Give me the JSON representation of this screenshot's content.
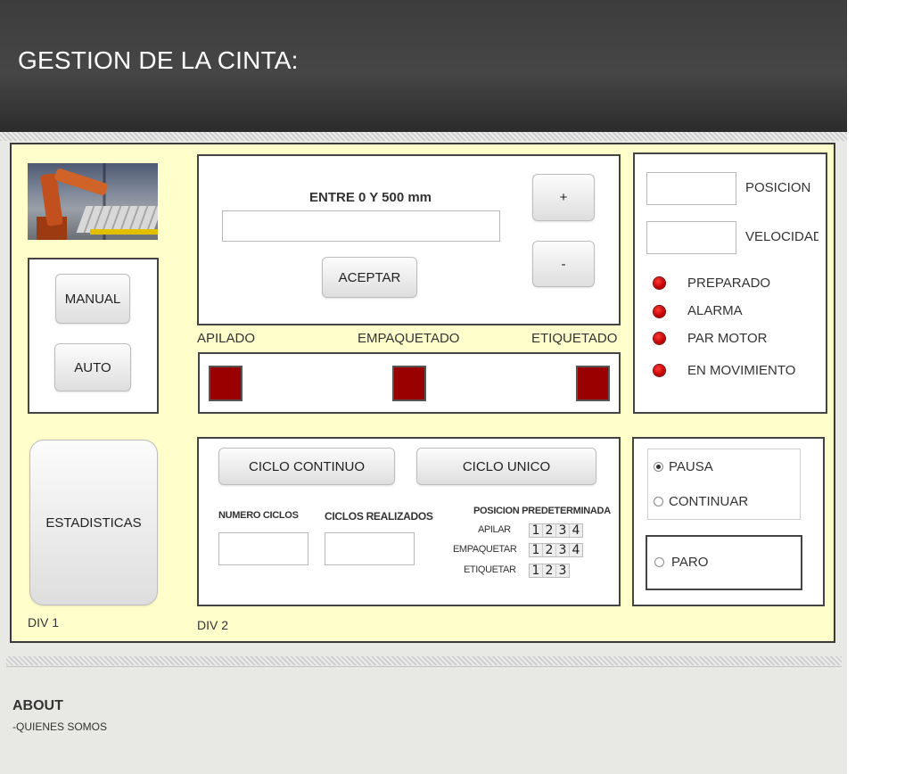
{
  "header": {
    "title": "GESTION DE LA CINTA:"
  },
  "div1": {
    "label": "DIV 1",
    "mode_buttons": {
      "manual": "MANUAL",
      "auto": "AUTO"
    },
    "stats_button": "ESTADISTICAS"
  },
  "position_panel": {
    "prompt": "ENTRE 0 Y 500 mm",
    "input_value": "",
    "accept": "ACEPTAR",
    "plus": "+",
    "minus": "-"
  },
  "stations": {
    "labels": [
      "APILADO",
      "EMPAQUETADO",
      "ETIQUETADO"
    ],
    "indicator_color": "#990000"
  },
  "status_panel": {
    "posicion_label": "POSICION",
    "posicion_value": "",
    "velocidad_label": "VELOCIDAD",
    "velocidad_value": "",
    "led_color": "#cc0000",
    "indicators": [
      "PREPARADO",
      "ALARMA",
      "PAR MOTOR",
      "EN MOVIMIENTO"
    ]
  },
  "div2": {
    "label": "DIV 2",
    "cycle_buttons": {
      "continuous": "CICLO CONTINUO",
      "single": "CICLO UNICO"
    },
    "numero_ciclos_label": "NUMERO CICLOS",
    "numero_ciclos_value": "",
    "ciclos_realizados_label": "CICLOS REALIZADOS",
    "ciclos_realizados_value": "",
    "preset_title": "POSICION PREDETERMINADA",
    "presets": [
      {
        "label": "APILAR",
        "options": [
          "1",
          "2",
          "3",
          "4"
        ]
      },
      {
        "label": "EMPAQUETAR",
        "options": [
          "1",
          "2",
          "3",
          "4"
        ]
      },
      {
        "label": "ETIQUETAR",
        "options": [
          "1",
          "2",
          "3"
        ]
      }
    ]
  },
  "control_panel": {
    "pausa": "PAUSA",
    "pausa_checked": true,
    "continuar": "CONTINUAR",
    "paro": "PARO"
  },
  "footer": {
    "title": "ABOUT",
    "link": "-QUIENES SOMOS"
  }
}
